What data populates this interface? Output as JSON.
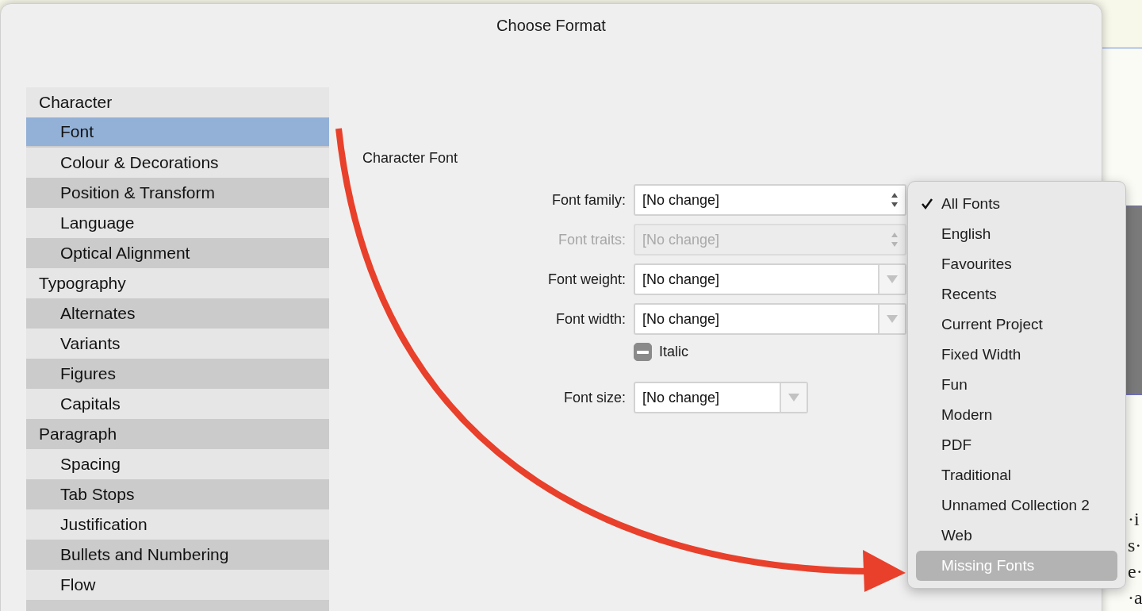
{
  "dialog": {
    "title": "Choose Format"
  },
  "sidebar": {
    "items": [
      {
        "label": "Character",
        "selected": false,
        "children": [
          {
            "label": "Font",
            "selected": true
          },
          {
            "label": "Colour & Decorations",
            "selected": false
          },
          {
            "label": "Position & Transform",
            "selected": false
          },
          {
            "label": "Language",
            "selected": false
          },
          {
            "label": "Optical Alignment",
            "selected": false
          }
        ]
      },
      {
        "label": "Typography",
        "selected": false,
        "children": [
          {
            "label": "Alternates",
            "selected": false
          },
          {
            "label": "Variants",
            "selected": false
          },
          {
            "label": "Figures",
            "selected": false
          },
          {
            "label": "Capitals",
            "selected": false
          }
        ]
      },
      {
        "label": "Paragraph",
        "selected": false,
        "children": [
          {
            "label": "Spacing",
            "selected": false
          },
          {
            "label": "Tab Stops",
            "selected": false
          },
          {
            "label": "Justification",
            "selected": false
          },
          {
            "label": "Bullets and Numbering",
            "selected": false
          },
          {
            "label": "Flow",
            "selected": false
          }
        ]
      }
    ]
  },
  "panel": {
    "heading": "Character Font",
    "fields": [
      {
        "kind": "stepper",
        "label": "Font family:",
        "value": "[No change]",
        "disabled": false
      },
      {
        "kind": "stepper",
        "label": "Font traits:",
        "value": "[No change]",
        "disabled": true
      },
      {
        "kind": "combo",
        "label": "Font weight:",
        "value": "[No change]",
        "disabled": false
      },
      {
        "kind": "combo",
        "label": "Font width:",
        "value": "[No change]",
        "disabled": false
      },
      {
        "kind": "checkbox",
        "label": "Italic",
        "mixed": true
      },
      {
        "kind": "combo",
        "label": "Font size:",
        "value": "[No change]",
        "disabled": false,
        "short": true
      }
    ]
  },
  "menu": {
    "items": [
      {
        "label": "All Fonts",
        "checked": true,
        "selected": false
      },
      {
        "label": "English",
        "checked": false,
        "selected": false
      },
      {
        "label": "Favourites",
        "checked": false,
        "selected": false
      },
      {
        "label": "Recents",
        "checked": false,
        "selected": false
      },
      {
        "label": "Current Project",
        "checked": false,
        "selected": false
      },
      {
        "label": "Fixed Width",
        "checked": false,
        "selected": false
      },
      {
        "label": "Fun",
        "checked": false,
        "selected": false
      },
      {
        "label": "Modern",
        "checked": false,
        "selected": false
      },
      {
        "label": "PDF",
        "checked": false,
        "selected": false
      },
      {
        "label": "Traditional",
        "checked": false,
        "selected": false
      },
      {
        "label": "Unnamed Collection 2",
        "checked": false,
        "selected": false
      },
      {
        "label": "Web",
        "checked": false,
        "selected": false
      },
      {
        "label": "Missing Fonts",
        "checked": false,
        "selected": true
      }
    ]
  },
  "background_document": {
    "text_fragments": [
      "·i",
      "s·",
      "e·",
      "·a"
    ]
  }
}
